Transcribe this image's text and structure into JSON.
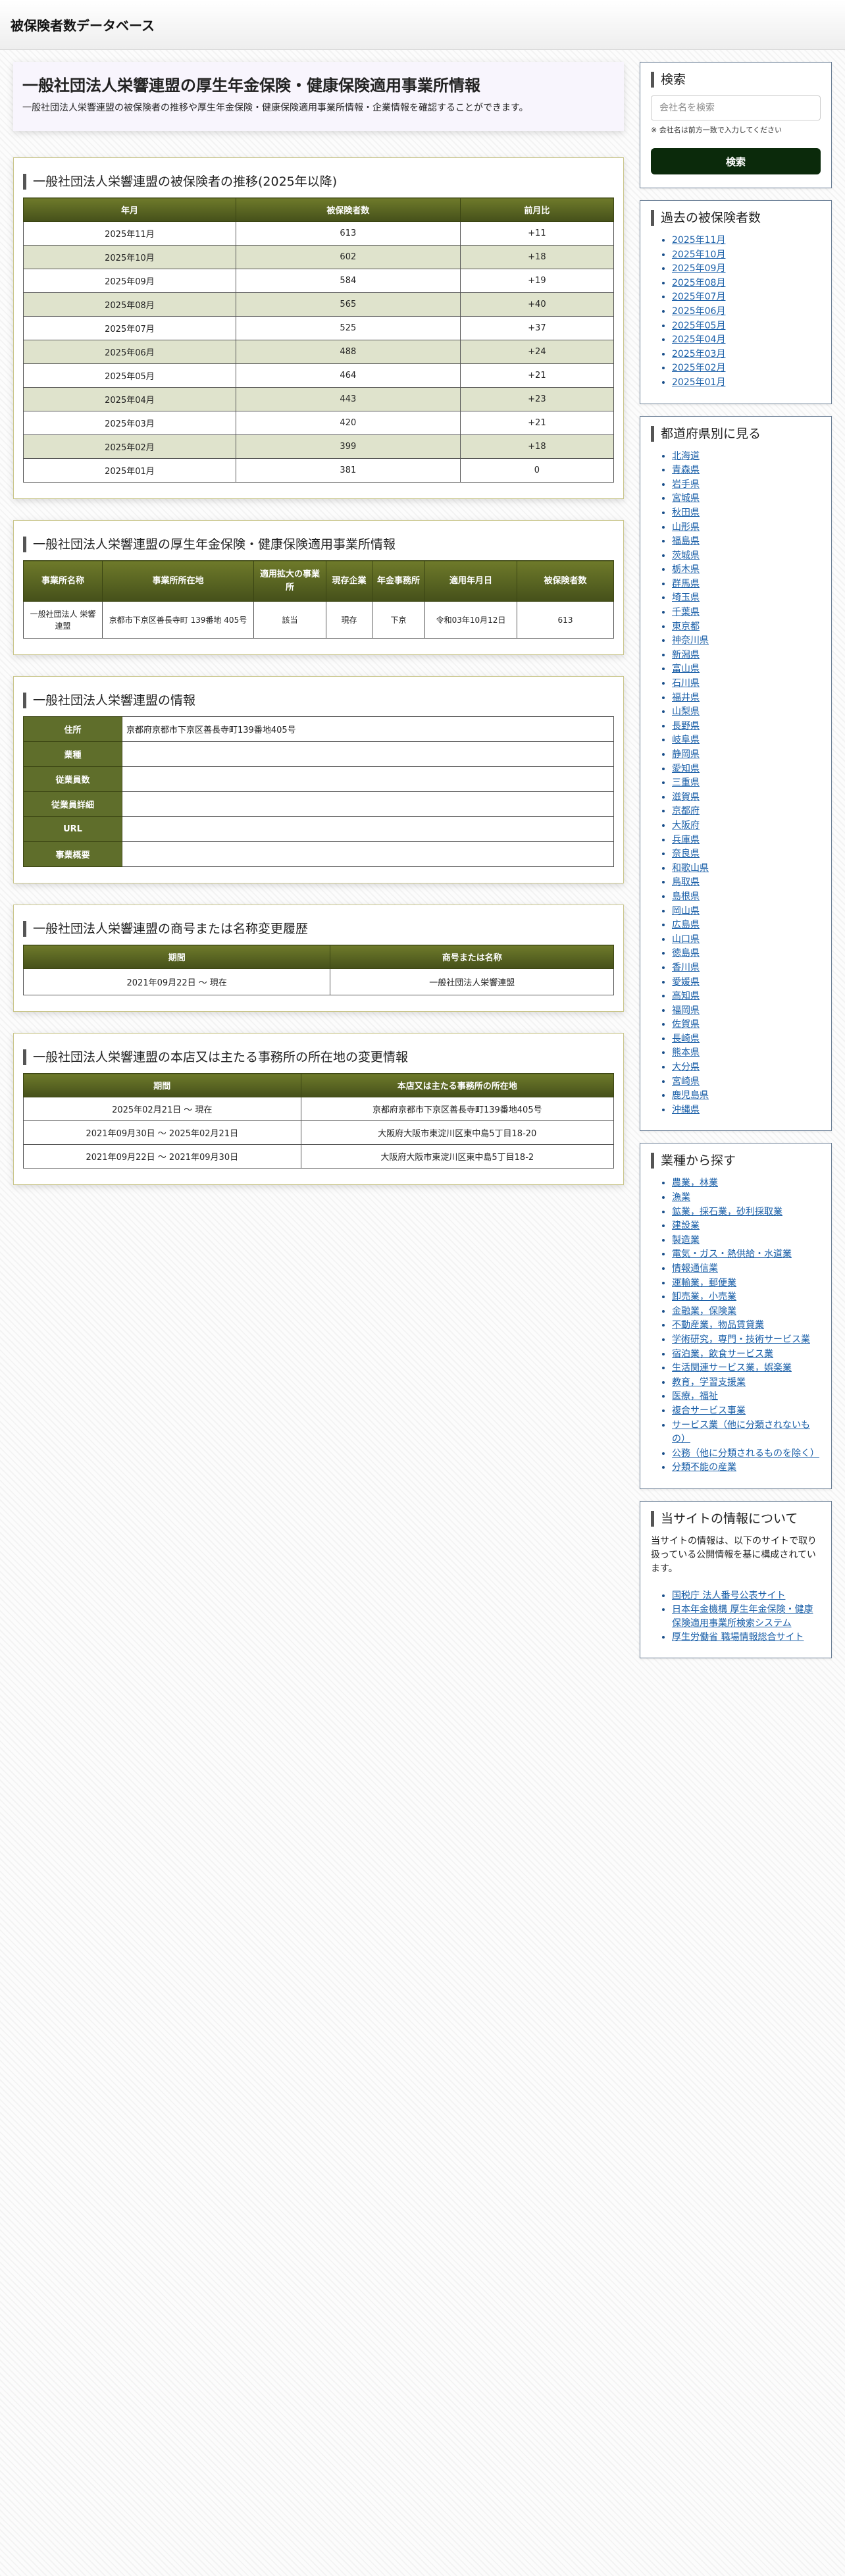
{
  "site": {
    "title": "被保険者数データベース"
  },
  "hero": {
    "title": "一般社団法人栄響連盟の厚生年金保険・健康保険適用事業所情報",
    "description": "一般社団法人栄響連盟の被保険者の推移や厚生年金保険・健康保険適用事業所情報・企業情報を確認することができます。"
  },
  "trend": {
    "title": "一般社団法人栄響連盟の被保険者の推移(2025年以降)",
    "headers": [
      "年月",
      "被保険者数",
      "前月比"
    ],
    "rows": [
      [
        "2025年11月",
        "613",
        "+11"
      ],
      [
        "2025年10月",
        "602",
        "+18"
      ],
      [
        "2025年09月",
        "584",
        "+19"
      ],
      [
        "2025年08月",
        "565",
        "+40"
      ],
      [
        "2025年07月",
        "525",
        "+37"
      ],
      [
        "2025年06月",
        "488",
        "+24"
      ],
      [
        "2025年05月",
        "464",
        "+21"
      ],
      [
        "2025年04月",
        "443",
        "+23"
      ],
      [
        "2025年03月",
        "420",
        "+21"
      ],
      [
        "2025年02月",
        "399",
        "+18"
      ],
      [
        "2025年01月",
        "381",
        "0"
      ]
    ]
  },
  "office": {
    "title": "一般社団法人栄響連盟の厚生年金保険・健康保険適用事業所情報",
    "headers": [
      "事業所名称",
      "事業所所在地",
      "適用拡大の事業所",
      "現存企業",
      "年金事務所",
      "適用年月日",
      "被保険者数"
    ],
    "row": [
      "一般社団法人 栄響連盟",
      "京都市下京区善長寺町 139番地 405号",
      "該当",
      "現存",
      "下京",
      "令和03年10月12日",
      "613"
    ]
  },
  "info": {
    "title": "一般社団法人栄響連盟の情報",
    "rows": [
      {
        "label": "住所",
        "value": "京都府京都市下京区善長寺町139番地405号"
      },
      {
        "label": "業種",
        "value": ""
      },
      {
        "label": "従業員数",
        "value": ""
      },
      {
        "label": "従業員詳細",
        "value": ""
      },
      {
        "label": "URL",
        "value": ""
      },
      {
        "label": "事業概要",
        "value": ""
      }
    ]
  },
  "history": {
    "title": "一般社団法人栄響連盟の商号または名称変更履歴",
    "headers": [
      "期間",
      "商号または名称"
    ],
    "rows": [
      [
        "2021年09月22日 〜 現在",
        "一般社団法人栄響連盟"
      ]
    ]
  },
  "address": {
    "title": "一般社団法人栄響連盟の本店又は主たる事務所の所在地の変更情報",
    "headers": [
      "期間",
      "本店又は主たる事務所の所在地"
    ],
    "rows": [
      [
        "2025年02月21日 〜 現在",
        "京都府京都市下京区善長寺町139番地405号"
      ],
      [
        "2021年09月30日 〜 2025年02月21日",
        "大阪府大阪市東淀川区東中島5丁目18-20"
      ],
      [
        "2021年09月22日 〜 2021年09月30日",
        "大阪府大阪市東淀川区東中島5丁目18-2"
      ]
    ]
  },
  "search": {
    "title": "検索",
    "placeholder": "会社名を検索",
    "hint": "※ 会社名は前方一致で入力してください",
    "button": "検索"
  },
  "past": {
    "title": "過去の被保険者数",
    "items": [
      "2025年11月",
      "2025年10月",
      "2025年09月",
      "2025年08月",
      "2025年07月",
      "2025年06月",
      "2025年05月",
      "2025年04月",
      "2025年03月",
      "2025年02月",
      "2025年01月"
    ]
  },
  "prefs": {
    "title": "都道府県別に見る",
    "items": [
      "北海道",
      "青森県",
      "岩手県",
      "宮城県",
      "秋田県",
      "山形県",
      "福島県",
      "茨城県",
      "栃木県",
      "群馬県",
      "埼玉県",
      "千葉県",
      "東京都",
      "神奈川県",
      "新潟県",
      "富山県",
      "石川県",
      "福井県",
      "山梨県",
      "長野県",
      "岐阜県",
      "静岡県",
      "愛知県",
      "三重県",
      "滋賀県",
      "京都府",
      "大阪府",
      "兵庫県",
      "奈良県",
      "和歌山県",
      "鳥取県",
      "島根県",
      "岡山県",
      "広島県",
      "山口県",
      "徳島県",
      "香川県",
      "愛媛県",
      "高知県",
      "福岡県",
      "佐賀県",
      "長崎県",
      "熊本県",
      "大分県",
      "宮崎県",
      "鹿児島県",
      "沖縄県"
    ]
  },
  "industries": {
    "title": "業種から探す",
    "items": [
      "農業，林業",
      "漁業",
      "鉱業，採石業，砂利採取業",
      "建設業",
      "製造業",
      "電気・ガス・熱供給・水道業",
      "情報通信業",
      "運輸業，郵便業",
      "卸売業，小売業",
      "金融業，保険業",
      "不動産業，物品賃貸業",
      "学術研究，専門・技術サービス業",
      "宿泊業，飲食サービス業",
      "生活関連サービス業，娯楽業",
      "教育，学習支援業",
      "医療，福祉",
      "複合サービス事業",
      "サービス業（他に分類されないもの）",
      "公務（他に分類されるものを除く）",
      "分類不能の産業"
    ]
  },
  "about": {
    "title": "当サイトの情報について",
    "text": "当サイトの情報は、以下のサイトで取り扱っている公開情報を基に構成されています。",
    "links": [
      "国税庁 法人番号公表サイト",
      "日本年金機構 厚生年金保険・健康保険適用事業所検索システム",
      "厚生労働省 職場情報総合サイト"
    ]
  }
}
